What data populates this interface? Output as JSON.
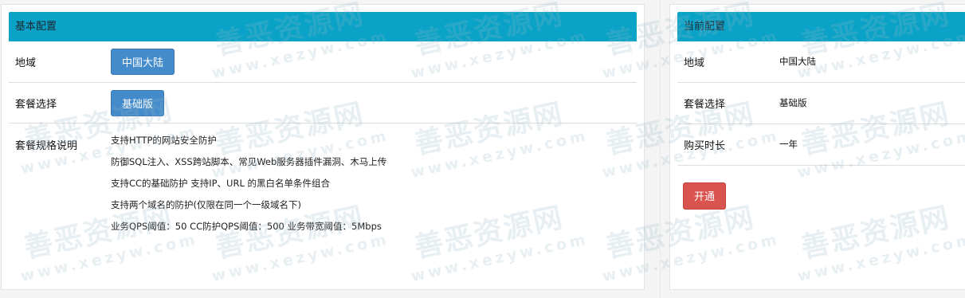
{
  "left_panel": {
    "title": "基本配置",
    "region_label": "地域",
    "region_button": "中国大陆",
    "plan_label": "套餐选择",
    "plan_button": "基础版",
    "spec_label": "套餐规格说明",
    "spec_items": [
      "支持HTTP的网站安全防护",
      "防御SQL注入、XSS跨站脚本、常见Web服务器插件漏洞、木马上传",
      "支持CC的基础防护 支持IP、URL 的黑白名单条件组合",
      "支持两个域名的防护(仅限在同一个一级域名下)",
      "业务QPS阈值：50 CC防护QPS阈值：500 业务带宽阈值：5Mbps"
    ]
  },
  "right_panel": {
    "title": "当前配置",
    "region_label": "地域",
    "region_value": "中国大陆",
    "plan_label": "套餐选择",
    "plan_value": "基础版",
    "duration_label": "购买时长",
    "duration_value": "一年",
    "open_button": "开通"
  },
  "watermark": {
    "cn": "善恶资源网",
    "en": "www.xezyw.com"
  },
  "colors": {
    "header": "#0aa3c7",
    "primary_button": "#438bca",
    "danger_button": "#d9534f"
  }
}
